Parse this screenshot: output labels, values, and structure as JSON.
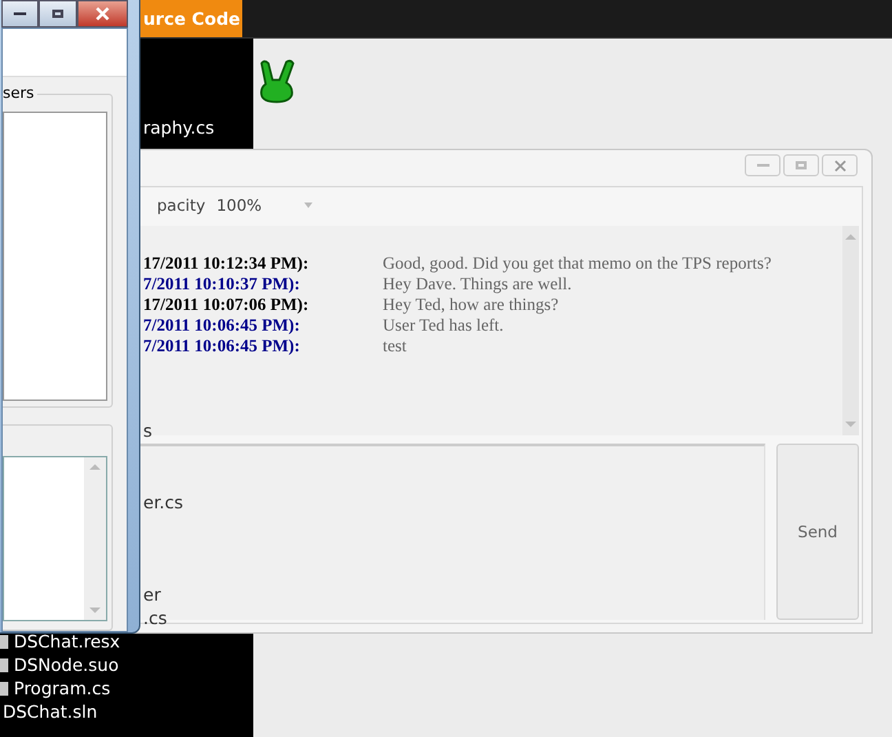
{
  "background_app": {
    "tab": "urce Code",
    "files": [
      {
        "name": "raphy.cs",
        "icon": false
      },
      {
        "name": "s",
        "icon": false
      },
      {
        "name": "er.cs",
        "icon": false
      },
      {
        "name": "er",
        "icon": false
      },
      {
        "name": ".cs",
        "icon": false
      },
      {
        "name": "DSChat.resx",
        "icon": true
      },
      {
        "name": "DSNode.suo",
        "icon": true
      },
      {
        "name": "Program.cs",
        "icon": true
      },
      {
        "name": "DSChat.sln",
        "icon": false
      }
    ]
  },
  "chat_window": {
    "opacity_label": "pacity",
    "opacity_value": "100%",
    "messages": [
      {
        "time": "17/2011 10:12:34 PM):",
        "text": "Good, good. Did you get that memo on the TPS reports?",
        "color": "#000000"
      },
      {
        "time": "7/2011 10:10:37 PM):",
        "text": "Hey Dave. Things are well.",
        "color": "#00008b"
      },
      {
        "time": "17/2011 10:07:06 PM):",
        "text": "Hey Ted, how are things?",
        "color": "#000000"
      },
      {
        "time": "7/2011 10:06:45 PM):",
        "text": "User Ted has left.",
        "color": "#00008b"
      },
      {
        "time": "7/2011 10:06:45 PM):",
        "text": "test",
        "color": "#00008b"
      }
    ],
    "send_button": "Send"
  },
  "users_window": {
    "users_group_label": "sers"
  }
}
